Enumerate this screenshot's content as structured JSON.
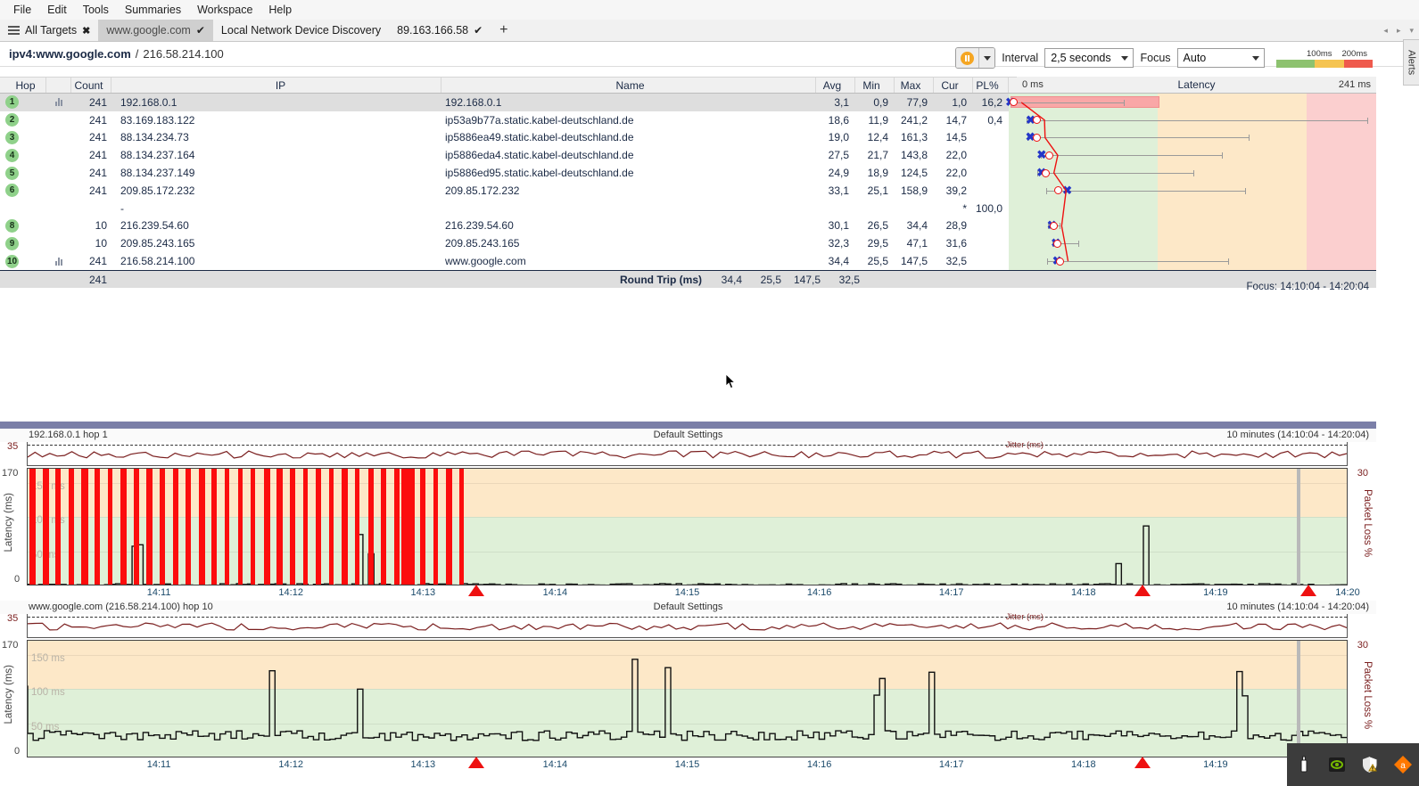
{
  "menu": {
    "items": [
      "File",
      "Edit",
      "Tools",
      "Summaries",
      "Workspace",
      "Help"
    ]
  },
  "tabs": {
    "items": [
      {
        "label": "All Targets",
        "icon": "hamburger-icon",
        "close": "✖",
        "active": false
      },
      {
        "label": "www.google.com",
        "icon": "check-icon",
        "check": "✔",
        "active": true
      },
      {
        "label": "Local Network Device Discovery",
        "active": false
      },
      {
        "label": "89.163.166.58",
        "check": "✔",
        "active": false
      }
    ],
    "add_label": "+",
    "nav_prev": "◂",
    "nav_next": "▸",
    "nav_menu": "▾"
  },
  "target": {
    "prefix": "ipv4:www.google.com",
    "separator": "/",
    "ip": "216.58.214.100"
  },
  "toolbar": {
    "pause_icon": "pause-icon",
    "dropdown_icon": "chevron-down-icon",
    "interval_label": "Interval",
    "interval_value": "2,5 seconds",
    "focus_label": "Focus",
    "focus_value": "Auto",
    "legend": {
      "left": "100ms",
      "right": "200ms",
      "colors": [
        "#8dc26f",
        "#f5c451",
        "#ef5a4d"
      ]
    },
    "alerts_tab": "Alerts"
  },
  "table": {
    "columns": [
      "Hop",
      "Count",
      "IP",
      "Name",
      "Avg",
      "Min",
      "Max",
      "Cur",
      "PL%"
    ],
    "latency_header": {
      "left": "0 ms",
      "title": "Latency",
      "right": "241 ms"
    },
    "rows": [
      {
        "hop": "1",
        "chart_icon": "bar-chart-icon",
        "count": "241",
        "ip": "192.168.0.1",
        "name": "192.168.0.1",
        "avg": "3,1",
        "min": "0,9",
        "max": "77,9",
        "cur": "1,0",
        "pl": "16,2",
        "selected": true
      },
      {
        "hop": "2",
        "chart_icon": "",
        "count": "241",
        "ip": "83.169.183.122",
        "name": "ip53a9b77a.static.kabel-deutschland.de",
        "avg": "18,6",
        "min": "11,9",
        "max": "241,2",
        "cur": "14,7",
        "pl": "0,4",
        "selected": false
      },
      {
        "hop": "3",
        "chart_icon": "",
        "count": "241",
        "ip": "88.134.234.73",
        "name": "ip5886ea49.static.kabel-deutschland.de",
        "avg": "19,0",
        "min": "12,4",
        "max": "161,3",
        "cur": "14,5",
        "pl": "",
        "selected": false
      },
      {
        "hop": "4",
        "chart_icon": "",
        "count": "241",
        "ip": "88.134.237.164",
        "name": "ip5886eda4.static.kabel-deutschland.de",
        "avg": "27,5",
        "min": "21,7",
        "max": "143,8",
        "cur": "22,0",
        "pl": "",
        "selected": false
      },
      {
        "hop": "5",
        "chart_icon": "",
        "count": "241",
        "ip": "88.134.237.149",
        "name": "ip5886ed95.static.kabel-deutschland.de",
        "avg": "24,9",
        "min": "18,9",
        "max": "124,5",
        "cur": "22,0",
        "pl": "",
        "selected": false
      },
      {
        "hop": "6",
        "chart_icon": "",
        "count": "241",
        "ip": "209.85.172.232",
        "name": "209.85.172.232",
        "avg": "33,1",
        "min": "25,1",
        "max": "158,9",
        "cur": "39,2",
        "pl": "",
        "selected": false
      },
      {
        "hop": "",
        "chart_icon": "",
        "count": "",
        "ip": "-",
        "name": "",
        "avg": "",
        "min": "",
        "max": "",
        "cur": "*",
        "pl": "100,0",
        "selected": false
      },
      {
        "hop": "8",
        "chart_icon": "",
        "count": "10",
        "ip": "216.239.54.60",
        "name": "216.239.54.60",
        "avg": "30,1",
        "min": "26,5",
        "max": "34,4",
        "cur": "28,9",
        "pl": "",
        "selected": false
      },
      {
        "hop": "9",
        "chart_icon": "",
        "count": "10",
        "ip": "209.85.243.165",
        "name": "209.85.243.165",
        "avg": "32,3",
        "min": "29,5",
        "max": "47,1",
        "cur": "31,6",
        "pl": "",
        "selected": false
      },
      {
        "hop": "10",
        "chart_icon": "bar-chart-icon",
        "count": "241",
        "ip": "216.58.214.100",
        "name": "www.google.com",
        "avg": "34,4",
        "min": "25,5",
        "max": "147,5",
        "cur": "32,5",
        "pl": "",
        "selected": false
      }
    ],
    "summary": {
      "count": "241",
      "label": "Round Trip (ms)",
      "avg": "34,4",
      "min": "25,5",
      "max": "147,5",
      "cur": "32,5",
      "focus": "Focus: 14:10:04 - 14:20:04"
    }
  },
  "chart_data": [
    {
      "type": "line",
      "title": "192.168.0.1 hop 1",
      "subtitle": "Default Settings",
      "range_label": "10 minutes (14:10:04 - 14:20:04)",
      "ylabel": "Latency (ms)",
      "ylabel_right": "Packet Loss %",
      "jitter_label": "Jitter (ms)",
      "jitter_max": "35",
      "ylim": [
        0,
        170
      ],
      "ylim_right": [
        0,
        30
      ],
      "gridlabels": [
        "150 ms",
        "100 ms",
        "50 ms"
      ],
      "xticks": [
        "14:11",
        "14:12",
        "14:13",
        "14:14",
        "14:15",
        "14:16",
        "14:17",
        "14:18",
        "14:19",
        "14:20"
      ],
      "packet_loss_pct": 16.2,
      "alert_markers": [
        3.4,
        8.45,
        9.7
      ],
      "note": "Dense full-height red packet-loss bars from start through ~14:13:20, then sparse low latency trace"
    },
    {
      "type": "line",
      "title": "www.google.com (216.58.214.100) hop 10",
      "subtitle": "Default Settings",
      "range_label": "10 minutes (14:10:04 - 14:20:04)",
      "ylabel": "Latency (ms)",
      "ylabel_right": "Packet Loss %",
      "jitter_label": "Jitter (ms)",
      "jitter_max": "35",
      "ylim": [
        0,
        170
      ],
      "ylim_right": [
        0,
        30
      ],
      "gridlabels": [
        "150 ms",
        "100 ms",
        "50 ms"
      ],
      "xticks": [
        "14:11",
        "14:12",
        "14:13",
        "14:14",
        "14:15",
        "14:16",
        "14:17",
        "14:18",
        "14:19"
      ],
      "avg_latency": 34.4,
      "alert_markers": [
        3.4,
        8.45
      ],
      "note": "Continuous latency trace ~25-40ms with spikes to 150ms"
    }
  ],
  "tray": {
    "icons": [
      "usb-icon",
      "nvidia-icon",
      "shield-warning-icon",
      "avast-icon"
    ]
  }
}
